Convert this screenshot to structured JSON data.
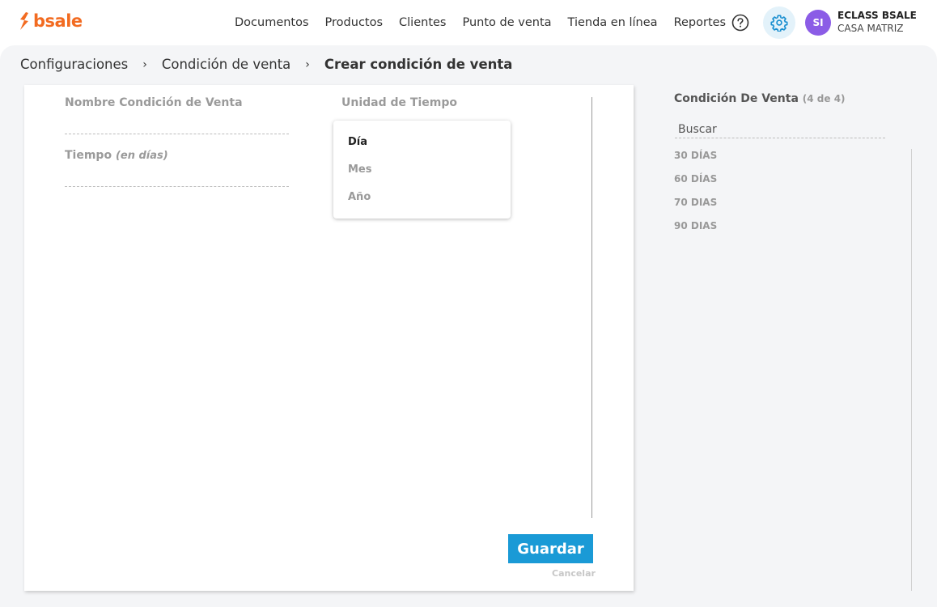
{
  "brand": {
    "logo_text": "bsale",
    "accent": "#f26b21"
  },
  "nav": {
    "items": [
      "Documentos",
      "Productos",
      "Clientes",
      "Punto de venta",
      "Tienda en línea",
      "Reportes"
    ]
  },
  "header": {
    "help_icon": "question-circle-icon",
    "settings_icon": "gear-icon",
    "avatar_initials": "SI",
    "user_name": "ECLASS BSALE",
    "user_branch": "CASA MATRIZ"
  },
  "breadcrumb": {
    "items": [
      "Configuraciones",
      "Condición de venta"
    ],
    "current": "Crear condición de venta",
    "separator": "›"
  },
  "form": {
    "name_label": "Nombre Condición de Venta",
    "name_value": "",
    "time_label": "Tiempo",
    "time_label_hint": "(en días)",
    "time_value": "",
    "unit_label": "Unidad de Tiempo",
    "unit_options": [
      "Día",
      "Mes",
      "Año"
    ],
    "unit_selected": "Día",
    "save_label": "Guardar",
    "cancel_label": "Cancelar",
    "primary_color": "#1a9ad6"
  },
  "sidebar": {
    "title": "Condición De Venta",
    "count_text": "(4 de 4)",
    "search_placeholder": "Buscar",
    "items": [
      "30 DÍAS",
      "60 DÍAS",
      "70 DIAS",
      "90 DIAS"
    ]
  }
}
